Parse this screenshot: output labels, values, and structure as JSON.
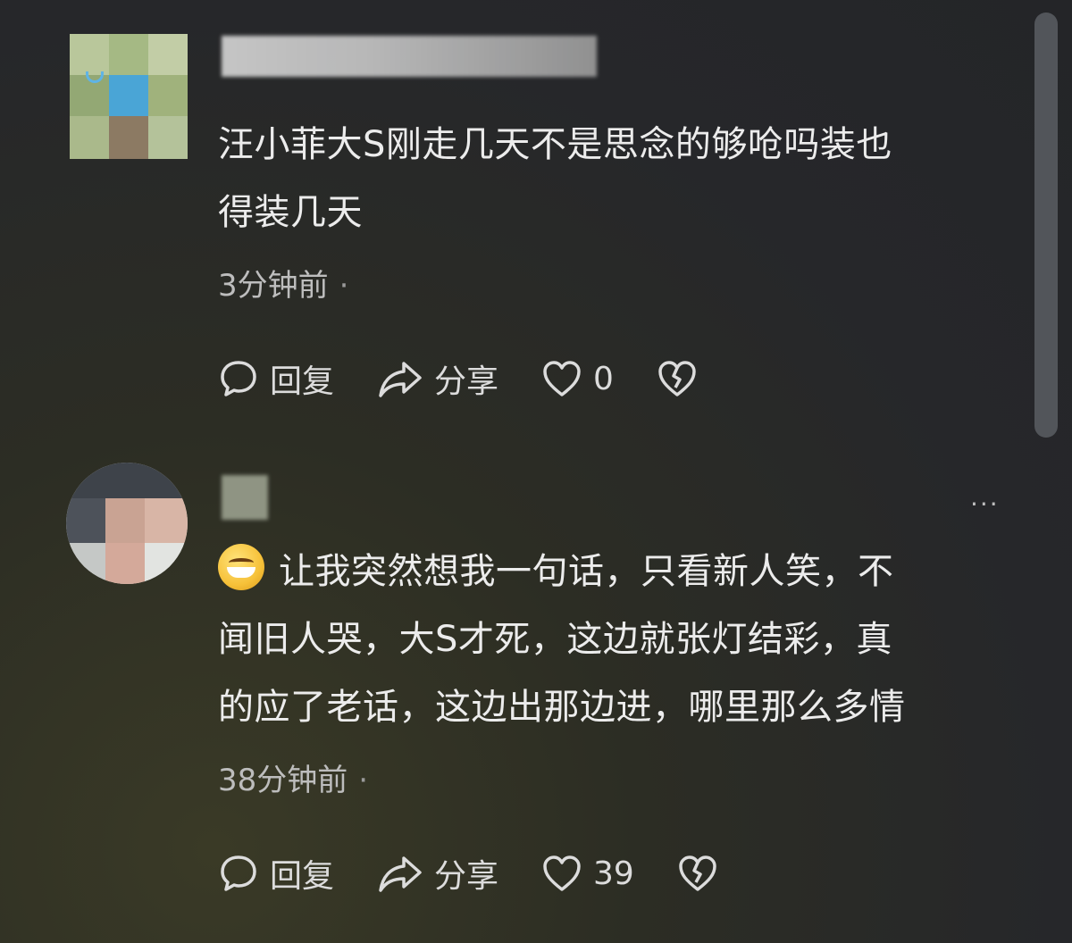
{
  "comments": [
    {
      "text_line1": "汪小菲大S刚走几天不是思念的够呛吗装也",
      "text_line2": "得装几天",
      "timestamp": "3分钟前",
      "dot": "·",
      "reply_label": "回复",
      "share_label": "分享",
      "like_count": "0"
    },
    {
      "text_line1": "让我突然想我一句话，只看新人笑，不",
      "text_line2": "闻旧人哭，大S才死，这边就张灯结彩，真",
      "text_line3": "的应了老话，这边出那边进，哪里那么多情",
      "timestamp": "38分钟前",
      "dot": "·",
      "reply_label": "回复",
      "share_label": "分享",
      "like_count": "39",
      "more_label": "···"
    }
  ],
  "icons": {
    "reply": "speech-bubble-icon",
    "share": "share-arrow-icon",
    "like": "heart-icon",
    "dislike": "broken-heart-icon",
    "emoji": "grinning-face-icon"
  },
  "colors": {
    "background": "#26272a",
    "text": "#ececec",
    "meta_text": "#bdbdbd"
  }
}
